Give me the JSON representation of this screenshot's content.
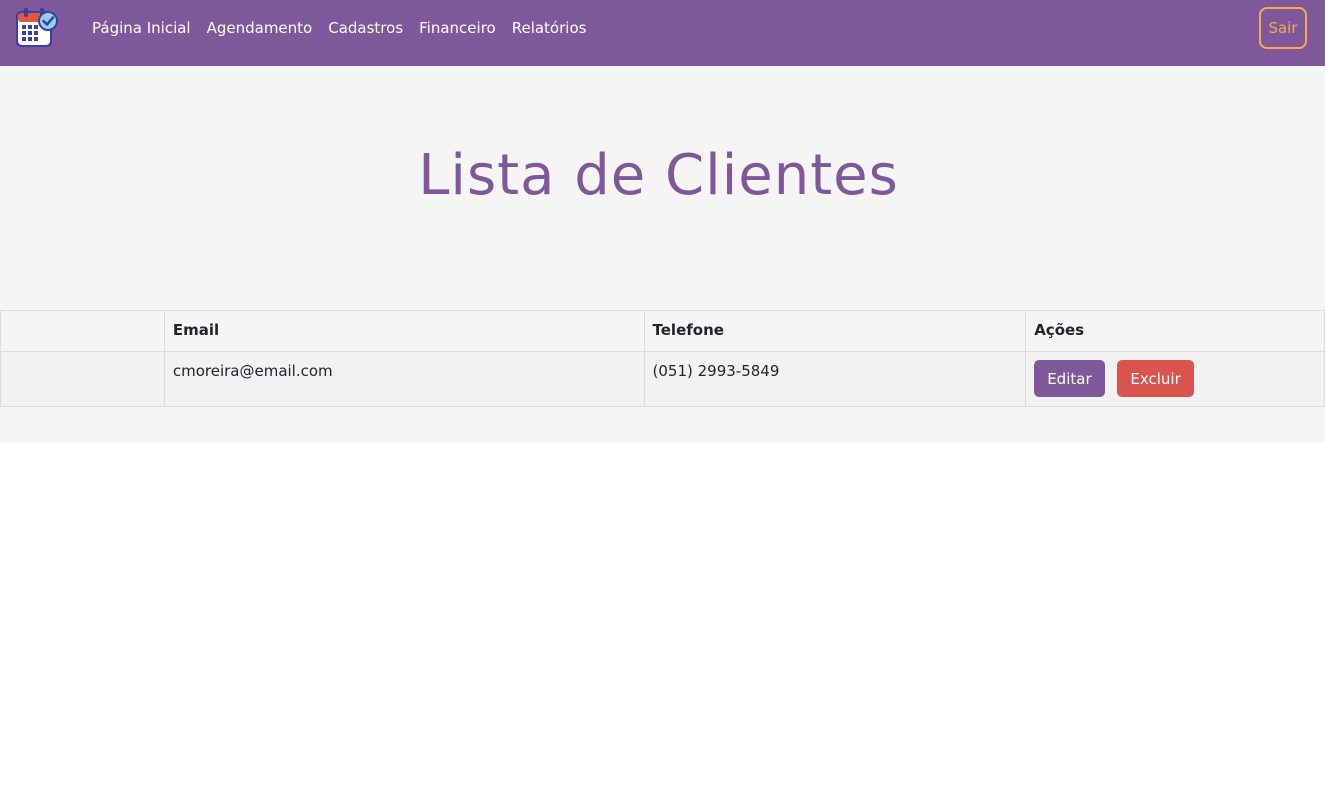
{
  "nav": {
    "items": [
      {
        "label": "Página Inicial"
      },
      {
        "label": "Agendamento"
      },
      {
        "label": "Cadastros"
      },
      {
        "label": "Financeiro"
      },
      {
        "label": "Relatórios"
      }
    ],
    "logout_label": "Sair",
    "logo_icon": "calendar-check-icon"
  },
  "page": {
    "title": "Lista de Clientes"
  },
  "table": {
    "headers": {
      "name": "",
      "email": "Email",
      "phone": "Telefone",
      "actions": "Ações"
    },
    "rows": [
      {
        "name": "",
        "email": "cmoreira@email.com",
        "phone": "(051) 2993-5849",
        "edit_label": "Editar",
        "delete_label": "Excluir"
      }
    ]
  },
  "colors": {
    "primary": "#7e589b",
    "warning": "#f0ad4e",
    "danger": "#d9534f",
    "content_bg": "#f5f5f5"
  }
}
